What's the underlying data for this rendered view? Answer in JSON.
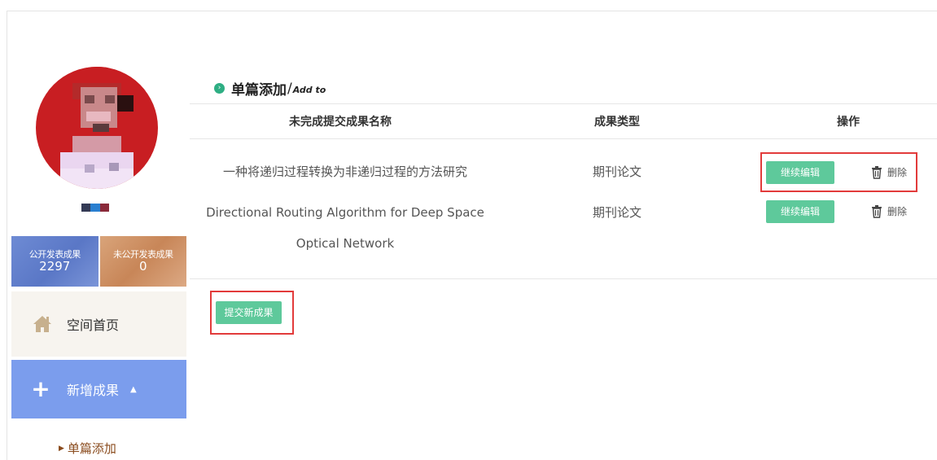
{
  "sidebar": {
    "stats": {
      "public_label": "公开发表成果",
      "public_value": "2297",
      "private_label": "未公开发表成果",
      "private_value": "0"
    },
    "nav": {
      "home_label": "空间首页",
      "home_icon": "home-icon",
      "add_label": "新增成果",
      "add_icon": "plus-icon",
      "add_caret": "▲",
      "sub_label": "单篇添加",
      "sub_marker": "▶"
    }
  },
  "main": {
    "section": {
      "title_cn": "单篇添加",
      "slash": "/",
      "title_en": "Add to"
    },
    "table": {
      "headers": {
        "name": "未完成提交成果名称",
        "type": "成果类型",
        "action": "操作"
      },
      "rows": [
        {
          "name_line1": "一种将递归过程转换为非递归过程的方法研究",
          "name_line2": "",
          "type": "期刊论文",
          "edit_label": "继续编辑",
          "delete_label": "删除"
        },
        {
          "name_line1": "Directional Routing Algorithm for Deep Space",
          "name_line2": "Optical Network",
          "type": "期刊论文",
          "edit_label": "继续编辑",
          "delete_label": "删除"
        }
      ]
    },
    "submit_label": "提交新成果"
  },
  "colors": {
    "accent_green": "#5ec99b",
    "nav_blue": "#7b9ded",
    "highlight_red": "#e23b3b"
  }
}
